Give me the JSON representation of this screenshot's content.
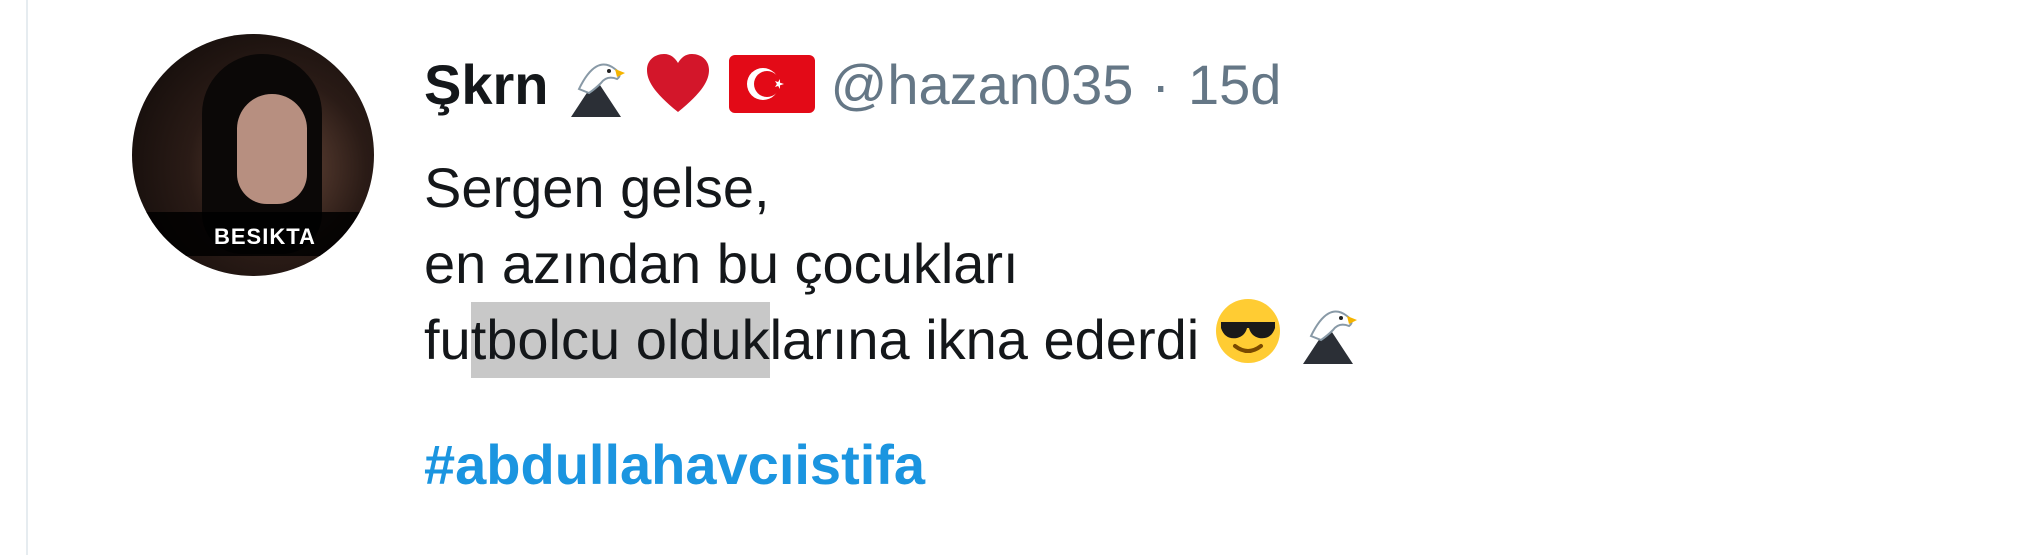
{
  "tweet": {
    "avatar": {
      "overlay_text": "BESIKTA"
    },
    "user": {
      "display_name": "Şkrn",
      "name_emojis": [
        "eagle-emoji",
        "red-heart-emoji",
        "turkey-flag-emoji"
      ],
      "handle": "@hazan035",
      "separator": "·",
      "time_ago": "15d"
    },
    "text_lines": {
      "line1": "Sergen gelse,",
      "line2": "en azından bu çocukları",
      "line3_pre": "fu",
      "line3_hl": "tbolcu olduk",
      "line3_post": "larına ikna ederdi"
    },
    "text_emojis": [
      "sunglasses-face-emoji",
      "eagle-emoji"
    ],
    "hashtag": "#abdullahavcıistifa",
    "colors": {
      "name": "#14171a",
      "meta": "#657786",
      "hashtag": "#1b95e0",
      "highlight": "#c8c8c8"
    }
  }
}
